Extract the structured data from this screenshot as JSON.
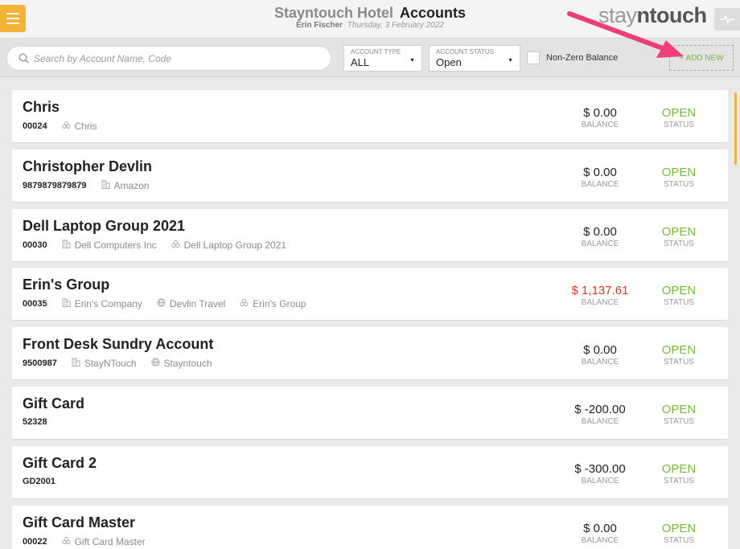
{
  "header": {
    "hotel": "Stayntouch Hotel",
    "page_title": "Accounts",
    "user": "Erin Fischer",
    "date": "Thursday, 3 February 2022",
    "logo_prefix": "stay",
    "logo_n": "n",
    "logo_suffix": "touch"
  },
  "filters": {
    "search_placeholder": "Search by Account Name, Code",
    "search_value": "",
    "account_type_label": "ACCOUNT TYPE",
    "account_type_value": "ALL",
    "account_status_label": "ACCOUNT STATUS",
    "account_status_value": "Open",
    "non_zero_label": "Non-Zero Balance",
    "add_new_label": "+ ADD NEW"
  },
  "captions": {
    "balance": "BALANCE",
    "status": "STATUS"
  },
  "accounts": [
    {
      "name": "Chris",
      "code": "00024",
      "tags": [
        {
          "icon": "group-icon",
          "text": "Chris"
        }
      ],
      "balance": "$ 0.00",
      "negative": false,
      "status": "OPEN"
    },
    {
      "name": "Christopher Devlin",
      "code": "9879879879879",
      "tags": [
        {
          "icon": "building-icon",
          "text": "Amazon"
        }
      ],
      "balance": "$ 0.00",
      "negative": false,
      "status": "OPEN"
    },
    {
      "name": "Dell Laptop Group 2021",
      "code": "00030",
      "tags": [
        {
          "icon": "building-icon",
          "text": "Dell Computers Inc"
        },
        {
          "icon": "group-icon",
          "text": "Dell Laptop Group 2021"
        }
      ],
      "balance": "$ 0.00",
      "negative": false,
      "status": "OPEN"
    },
    {
      "name": "Erin's Group",
      "code": "00035",
      "tags": [
        {
          "icon": "building-icon",
          "text": "Erin's Company"
        },
        {
          "icon": "globe-icon",
          "text": "Devlin Travel"
        },
        {
          "icon": "group-icon",
          "text": "Erin's Group"
        }
      ],
      "balance": "$ 1,137.61",
      "negative": true,
      "status": "OPEN"
    },
    {
      "name": "Front Desk Sundry Account",
      "code": "9500987",
      "tags": [
        {
          "icon": "building-icon",
          "text": "StayNTouch"
        },
        {
          "icon": "globe-icon",
          "text": "Stayntouch"
        }
      ],
      "balance": "$ 0.00",
      "negative": false,
      "status": "OPEN"
    },
    {
      "name": "Gift Card",
      "code": "52328",
      "tags": [],
      "balance": "$ -200.00",
      "negative": false,
      "status": "OPEN"
    },
    {
      "name": "Gift Card 2",
      "code": "GD2001",
      "tags": [],
      "balance": "$ -300.00",
      "negative": false,
      "status": "OPEN"
    },
    {
      "name": "Gift Card Master",
      "code": "00022",
      "tags": [
        {
          "icon": "group-icon",
          "text": "Gift Card Master"
        }
      ],
      "balance": "$ 0.00",
      "negative": false,
      "status": "OPEN"
    }
  ],
  "colors": {
    "accent": "#f5b336",
    "open_status": "#79b939",
    "negative_balance": "#d0392f",
    "annotation_arrow": "#ee3f7a"
  }
}
